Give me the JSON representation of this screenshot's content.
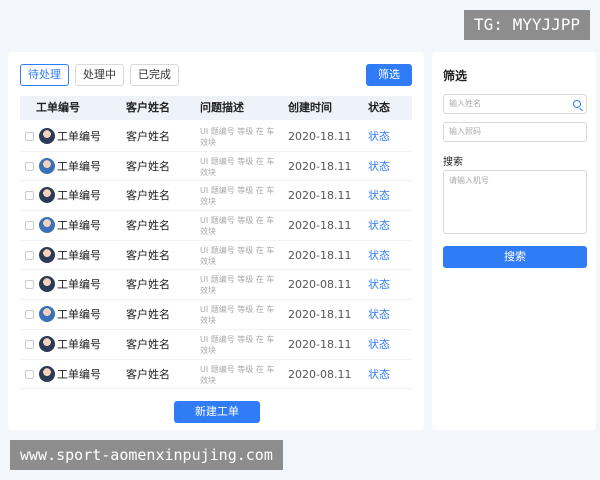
{
  "overlay": {
    "top_text": "TG: MYYJJPP",
    "bottom_text": "www.sport-aomenxinpujing.com"
  },
  "tabs": [
    {
      "label": "待处理",
      "active": true
    },
    {
      "label": "处理中",
      "active": false
    },
    {
      "label": "已完成",
      "active": false
    }
  ],
  "toolbar": {
    "filter_label": "筛选"
  },
  "table": {
    "headers": [
      "工单编号",
      "客户姓名",
      "问题描述",
      "创建时间",
      "状态"
    ],
    "rows": [
      {
        "id": "工单编号",
        "customer": "客户姓名",
        "desc": "UI 题编号  等级 在 车效块",
        "date": "2020-18.11",
        "status": "状态",
        "icon": "avatar-icon"
      },
      {
        "id": "工单编号",
        "customer": "客户姓名",
        "desc": "UI 题编号  等级 在 车效块",
        "date": "2020-18.11",
        "status": "状态",
        "icon": "avatar-icon"
      },
      {
        "id": "工单编号",
        "customer": "客户姓名",
        "desc": "UI 题编号  等级 在 车效块",
        "date": "2020-18.11",
        "status": "状态",
        "icon": "avatar-icon"
      },
      {
        "id": "工单编号",
        "customer": "客户姓名",
        "desc": "UI 题编号  等级 在 车效块",
        "date": "2020-18.11",
        "status": "状态",
        "icon": "avatar-icon"
      },
      {
        "id": "工单编号",
        "customer": "客户姓名",
        "desc": "UI 题编号  等级 在 车效块",
        "date": "2020-18.11",
        "status": "状态",
        "icon": "avatar-icon"
      },
      {
        "id": "工单编号",
        "customer": "客户姓名",
        "desc": "UI 题编号  等级 在 车效块",
        "date": "2020-08.11",
        "status": "状态",
        "icon": "avatar-icon"
      },
      {
        "id": "工单编号",
        "customer": "客户姓名",
        "desc": "UI 题编号  等级 在 车效块",
        "date": "2020-18.11",
        "status": "状态",
        "icon": "avatar-icon"
      },
      {
        "id": "工单编号",
        "customer": "客户姓名",
        "desc": "UI 题编号  等级 在 车效块",
        "date": "2020-18.11",
        "status": "状态",
        "icon": "avatar-icon"
      },
      {
        "id": "工单编号",
        "customer": "客户姓名",
        "desc": "UI 题编号  等级 在 车效块",
        "date": "2020-08.11",
        "status": "状态",
        "icon": "avatar-icon"
      }
    ]
  },
  "actions": {
    "new_ticket_label": "新建工单"
  },
  "filter_panel": {
    "title": "筛选",
    "name_placeholder": "输入姓名",
    "phone_placeholder": "输入照码",
    "search_label": "搜索",
    "textarea_placeholder": "请输入机号",
    "search_button_label": "搜索"
  },
  "colors": {
    "accent": "#2f7cf6",
    "background": "#f3f6fa",
    "header_bg": "#eef3f9"
  }
}
